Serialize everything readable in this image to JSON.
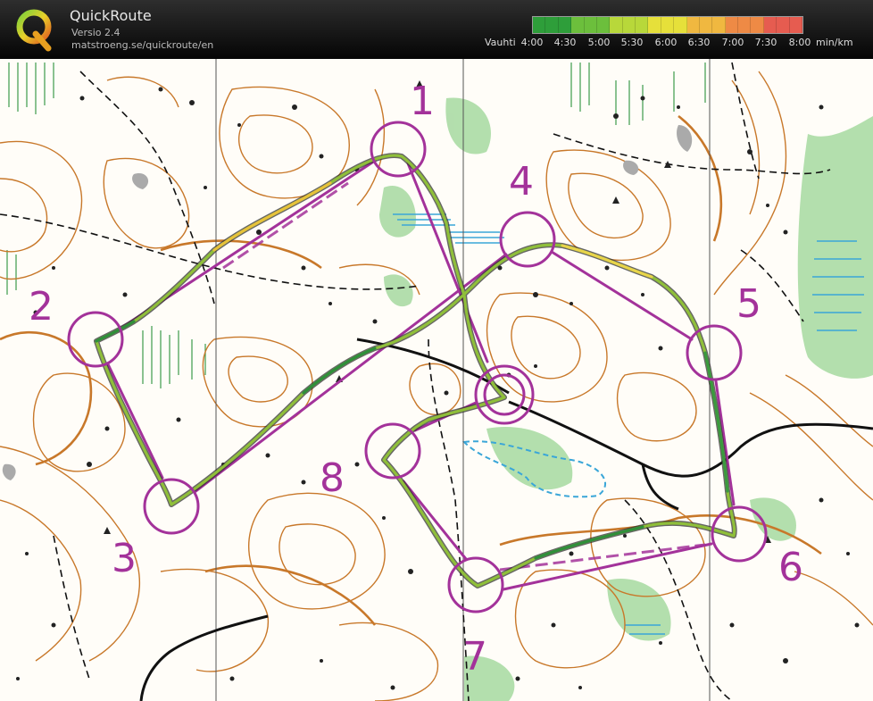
{
  "header": {
    "app_name": "QuickRoute",
    "version": "Versio 2.4",
    "url": "matstroeng.se/quickroute/en",
    "logo_icon": "quickroute-q-logo-icon"
  },
  "pace_legend": {
    "title": "Vauhti",
    "ticks": [
      "4:00",
      "4:30",
      "5:00",
      "5:30",
      "6:00",
      "6:30",
      "7:00",
      "7:30",
      "8:00"
    ],
    "unit": "min/km",
    "colors": [
      "#2e9e3a",
      "#6cbf3c",
      "#b8d83a",
      "#e6e03a",
      "#f0b840",
      "#ee8a45",
      "#e65c50"
    ]
  },
  "course": {
    "color": "#a3329a",
    "controls": [
      "1",
      "2",
      "3",
      "4",
      "5",
      "6",
      "7",
      "8"
    ]
  },
  "route_colors": {
    "fast": "#2f8f3a",
    "slow": "#d9c63a",
    "outline": "#333333"
  },
  "map_colors": {
    "contour": "#c8782a",
    "vegetation": "#9fd59b",
    "water": "#3aa6d8",
    "rock": "#222222"
  }
}
